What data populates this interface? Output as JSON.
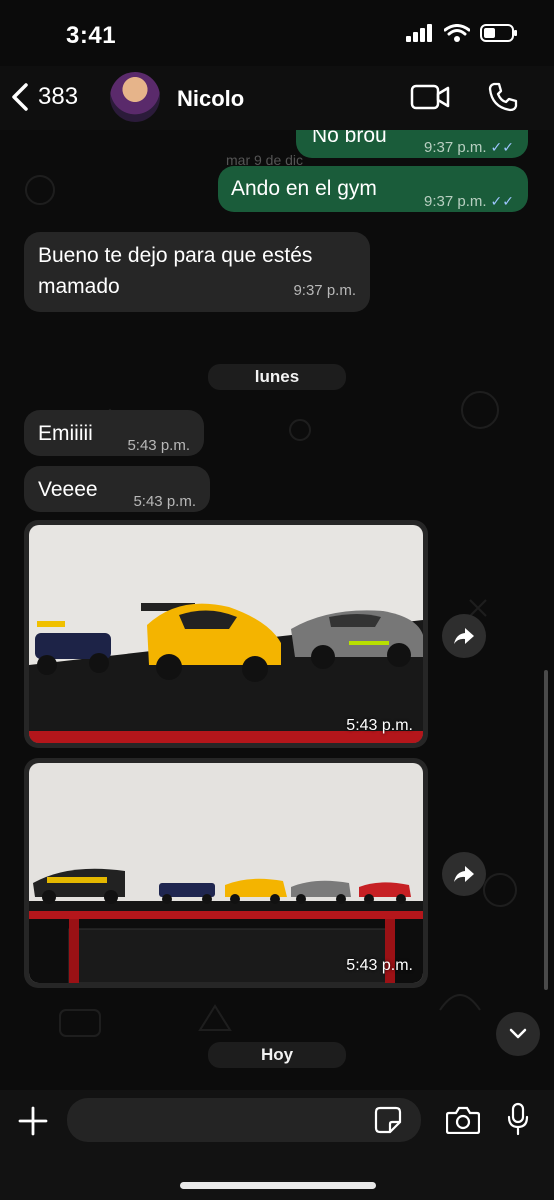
{
  "status_bar": {
    "time": "3:41"
  },
  "header": {
    "back_count": "383",
    "contact_name": "Nicolo"
  },
  "messages": {
    "m1": {
      "text": "No brou",
      "time": "9:37 p.m."
    },
    "date_faded": "mar 9 de dic",
    "m2": {
      "text": "Ando en el gym",
      "time": "9:37 p.m."
    },
    "m3": {
      "line1": "Bueno te dejo para que estés",
      "line2": "mamado",
      "time": "9:37 p.m."
    },
    "day1": "lunes",
    "m4": {
      "text": "Emiiiii",
      "time": "5:43 p.m."
    },
    "m5": {
      "text": "Veeee",
      "time": "5:43 p.m."
    },
    "photo1": {
      "time": "5:43 p.m."
    },
    "photo2": {
      "time": "5:43 p.m."
    },
    "day2": "Hoy"
  },
  "colors": {
    "incoming": "#262626",
    "outgoing": "#1a5c3a",
    "tick": "#9ec5ff"
  },
  "icons": [
    "chevron-left-icon",
    "video-call-icon",
    "phone-icon",
    "forward-icon",
    "chevron-down-icon",
    "plus-icon",
    "sticker-icon",
    "camera-icon",
    "mic-icon"
  ]
}
